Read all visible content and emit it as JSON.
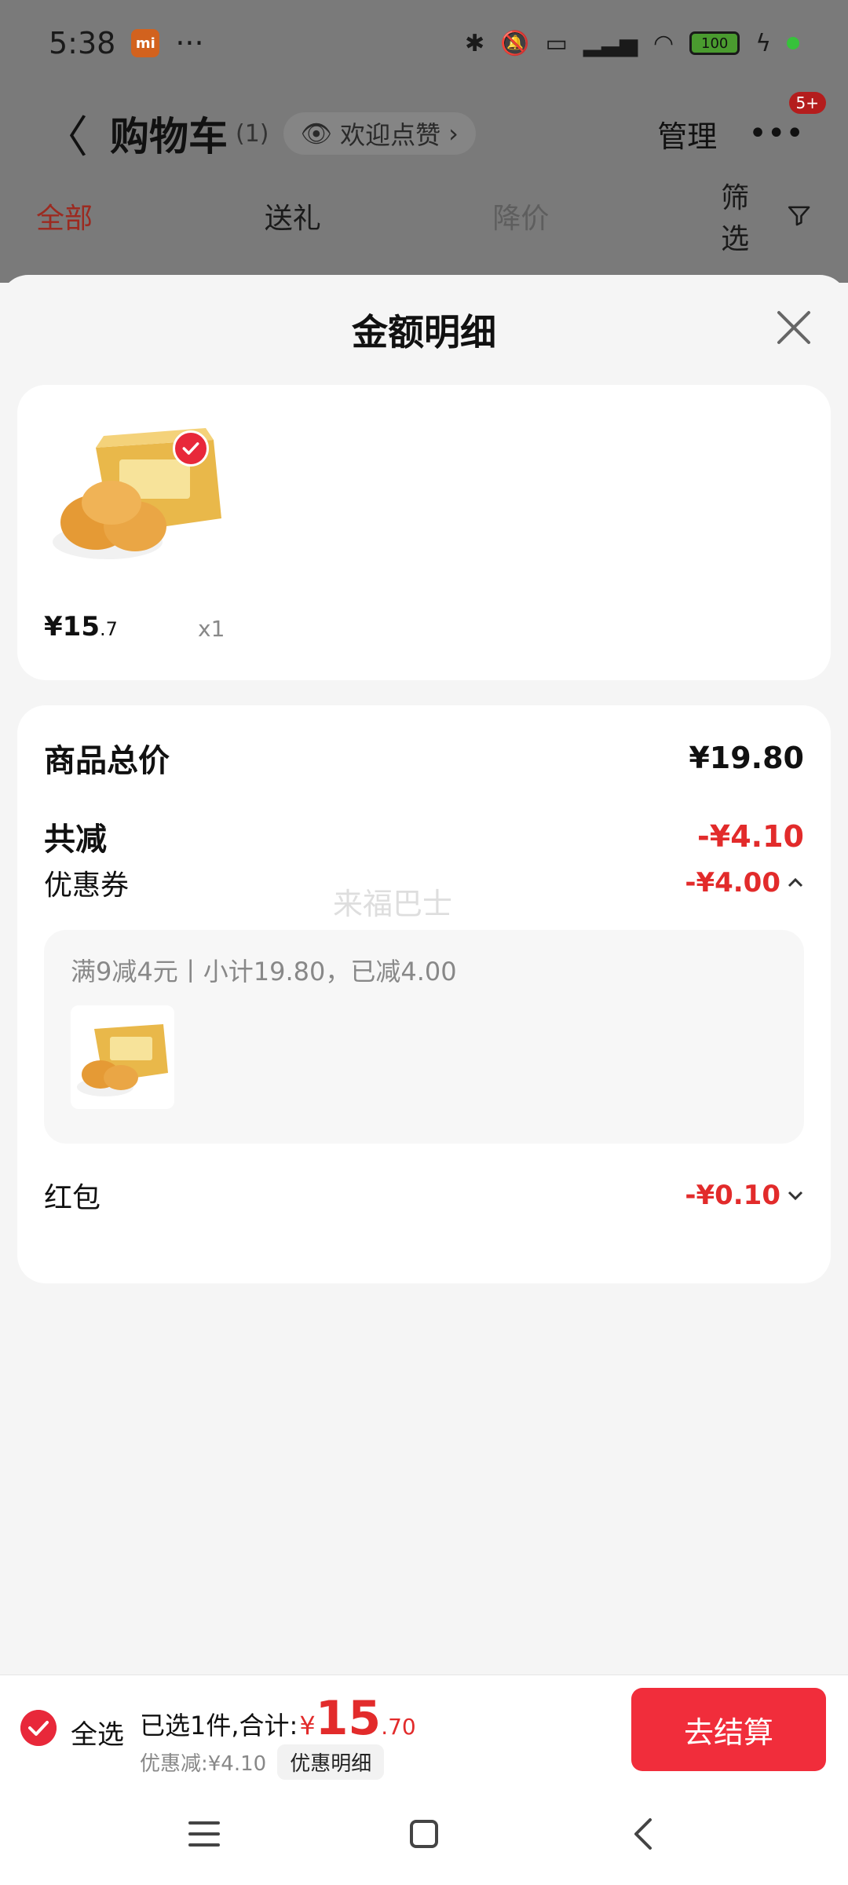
{
  "status_bar": {
    "time": "5:38",
    "mi_label": "mi",
    "more": "···",
    "battery": "100"
  },
  "nav": {
    "back": "〈",
    "title": "购物车",
    "count": "(1)",
    "pill_label": "欢迎点赞",
    "pill_chevron": "›",
    "manage": "管理",
    "more_dots": "•••",
    "badge": "5+"
  },
  "tabs": {
    "all": "全部",
    "gift": "送礼",
    "price_drop": "降价",
    "filter": "筛选"
  },
  "sheet": {
    "title": "金额明细",
    "product": {
      "price_int": "¥15",
      "price_dec": ".7",
      "qty": "x1"
    },
    "summary": {
      "total_label": "商品总价",
      "total_value": "¥19.80",
      "discount_label": "共减",
      "discount_value": "-¥4.10",
      "coupon_label": "优惠券",
      "coupon_value": "-¥4.00",
      "coupon_detail": "满9减4元丨小计19.80，已减4.00",
      "redpacket_label": "红包",
      "redpacket_value": "-¥0.10",
      "watermark": "来福巴士"
    }
  },
  "bottom_bar": {
    "select_all": "全选",
    "selected_text": "已选1件,合计:",
    "yen": "¥",
    "total_int": "15",
    "total_dec": ".70",
    "discount_text": "优惠减:¥4.10",
    "detail_button": "优惠明细",
    "checkout": "去结算"
  },
  "colors": {
    "accent_red": "#e22b2b",
    "checkout_red": "#f12d3b"
  }
}
